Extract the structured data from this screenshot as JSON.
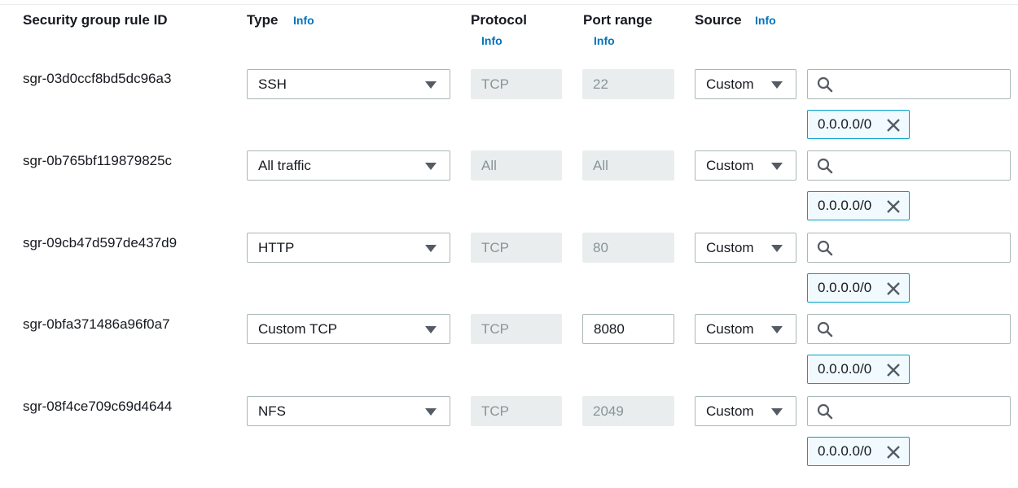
{
  "headers": {
    "rule_id": "Security group rule ID",
    "type": "Type",
    "protocol": "Protocol",
    "port_range": "Port range",
    "source": "Source",
    "info": "Info"
  },
  "rules": [
    {
      "id": "sgr-03d0ccf8bd5dc96a3",
      "type": "SSH",
      "protocol": "TCP",
      "port": "22",
      "port_editable": false,
      "source_type": "Custom",
      "search_value": "",
      "cidr": "0.0.0.0/0"
    },
    {
      "id": "sgr-0b765bf119879825c",
      "type": "All traffic",
      "protocol": "All",
      "port": "All",
      "port_editable": false,
      "source_type": "Custom",
      "search_value": "",
      "cidr": "0.0.0.0/0"
    },
    {
      "id": "sgr-09cb47d597de437d9",
      "type": "HTTP",
      "protocol": "TCP",
      "port": "80",
      "port_editable": false,
      "source_type": "Custom",
      "search_value": "",
      "cidr": "0.0.0.0/0"
    },
    {
      "id": "sgr-0bfa371486a96f0a7",
      "type": "Custom TCP",
      "protocol": "TCP",
      "port": "8080",
      "port_editable": true,
      "source_type": "Custom",
      "search_value": "",
      "cidr": "0.0.0.0/0"
    },
    {
      "id": "sgr-08f4ce709c69d4644",
      "type": "NFS",
      "protocol": "TCP",
      "port": "2049",
      "port_editable": false,
      "source_type": "Custom",
      "search_value": "",
      "cidr": "0.0.0.0/0"
    }
  ],
  "icons": {
    "type_dropdown": "caret-down-icon",
    "source_dropdown": "caret-down-icon",
    "search": "search-icon",
    "remove_token": "close-icon"
  },
  "colors": {
    "info_link": "#0073bb",
    "token_border": "#00a1c9",
    "token_bg": "#f1faff",
    "disabled_bg": "#eaeded",
    "disabled_text": "#879596"
  }
}
